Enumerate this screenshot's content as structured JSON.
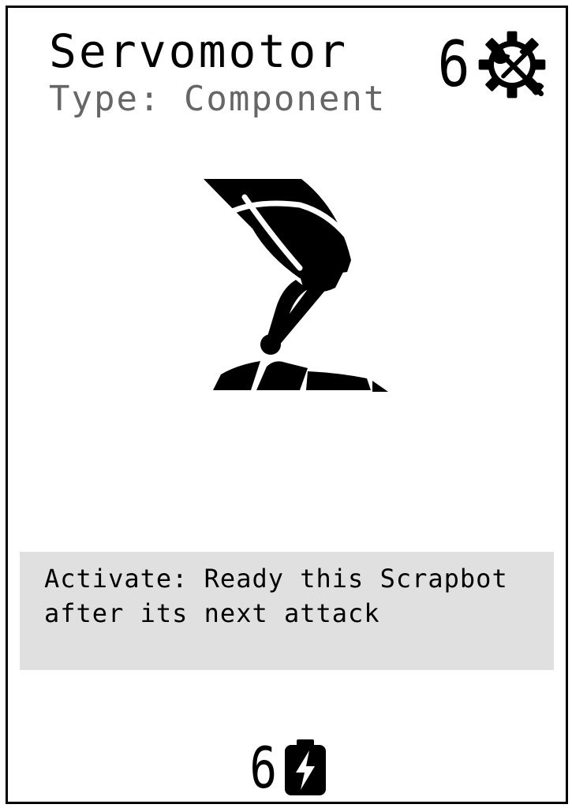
{
  "card": {
    "title": "Servomotor",
    "type_line": "Type: Component",
    "cost": {
      "value": "6",
      "icon": "gear-wrench-icon"
    },
    "art": {
      "icon": "robotic-leg-icon"
    },
    "ability_text": "Activate: Ready this Scrapbot after its next attack",
    "power": {
      "value": "6",
      "icon": "battery-bolt-icon"
    },
    "colors": {
      "border": "#000000",
      "text": "#000000",
      "subtitle": "#666666",
      "textbox_bg": "#e0e0e0"
    }
  }
}
